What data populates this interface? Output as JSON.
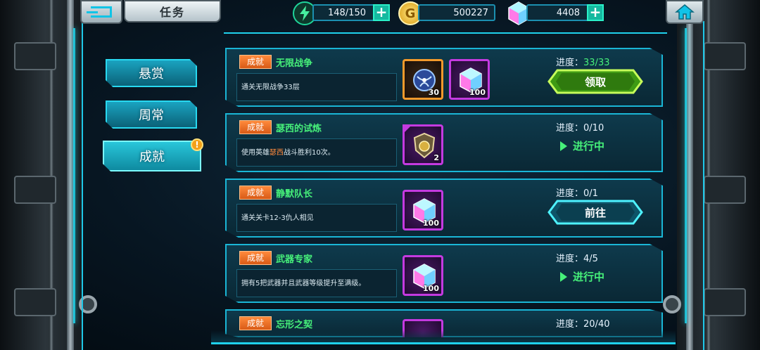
{
  "header": {
    "back_icon": "back-arrow-icon",
    "title": "任务",
    "home_icon": "home-icon"
  },
  "resources": {
    "energy": {
      "icon": "lightning-icon",
      "value": "148/150"
    },
    "gold": {
      "icon": "gold-coin-icon",
      "value": "500227"
    },
    "gems": {
      "icon": "gem-icon",
      "value": "4408"
    }
  },
  "tabs": [
    {
      "label": "悬赏",
      "active": false
    },
    {
      "label": "周常",
      "active": false
    },
    {
      "label": "成就",
      "active": true,
      "badge": "!"
    }
  ],
  "tasks": [
    {
      "tag": "成就",
      "name": "无限战争",
      "desc": "通关无限战争33层",
      "progress_label": "进度：",
      "progress": "33/33",
      "rewards": [
        {
          "icon": "sphere-orb-icon",
          "count": "30",
          "rarity": "orange"
        },
        {
          "icon": "gem-icon",
          "count": "100",
          "rarity": "purple"
        }
      ],
      "action": "领取",
      "state": "claim"
    },
    {
      "tag": "成就",
      "name": "瑟西的试炼",
      "desc_pre": "使用英雄",
      "desc_hl": "瑟西",
      "desc_post": "战斗胜利10次。",
      "progress_label": "进度：",
      "progress": "0/10",
      "rewards": [
        {
          "icon": "shield-relic-icon",
          "count": "2",
          "rarity": "purple"
        }
      ],
      "action": "进行中",
      "state": "in_progress"
    },
    {
      "tag": "成就",
      "name": "静默队长",
      "desc": "通关关卡12-3仇人相见",
      "progress_label": "进度：",
      "progress": "0/1",
      "rewards": [
        {
          "icon": "gem-icon",
          "count": "100",
          "rarity": "purple"
        }
      ],
      "action": "前往",
      "state": "go"
    },
    {
      "tag": "成就",
      "name": "武器专家",
      "desc": "拥有5把武器并且武器等级提升至满级。",
      "progress_label": "进度：",
      "progress": "4/5",
      "rewards": [
        {
          "icon": "gem-icon",
          "count": "100",
          "rarity": "purple"
        }
      ],
      "action": "进行中",
      "state": "in_progress"
    },
    {
      "tag": "成就",
      "name": "忘形之契",
      "progress_label": "进度：",
      "progress": "20/40"
    }
  ]
}
